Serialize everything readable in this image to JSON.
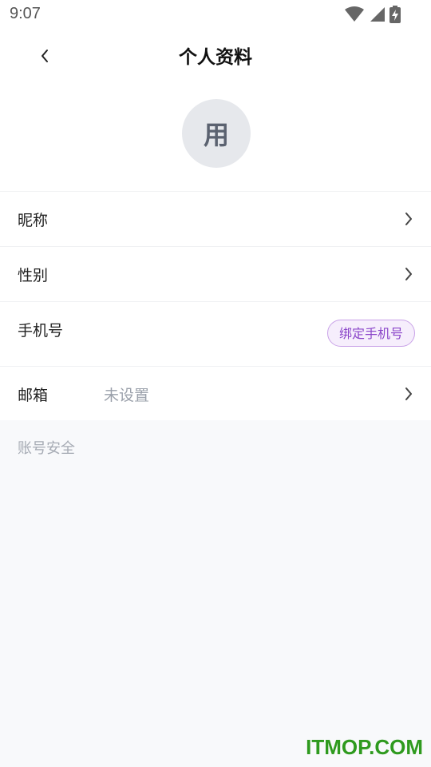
{
  "status_bar": {
    "time": "9:07",
    "icons": [
      "wifi-icon",
      "signal-icon",
      "battery-charging-icon"
    ]
  },
  "header": {
    "title": "个人资料",
    "back_icon": "chevron-left-icon"
  },
  "avatar": {
    "initial": "用"
  },
  "rows": [
    {
      "label": "昵称",
      "value": "",
      "action": "chevron"
    },
    {
      "label": "性别",
      "value": "",
      "action": "chevron"
    },
    {
      "label": "手机号",
      "value": "",
      "action_label": "绑定手机号"
    },
    {
      "label": "邮箱",
      "value": "未设置",
      "action": "chevron"
    }
  ],
  "section": {
    "title": "账号安全"
  },
  "watermark": "ITMOP.COM",
  "colors": {
    "accent": "#8a45c9",
    "accent_bg": "#f6eefc",
    "accent_border": "#c9a2e8",
    "page_bg": "#f8f9fb",
    "muted_text": "#9aa0aa",
    "watermark": "#2e9a1e"
  }
}
